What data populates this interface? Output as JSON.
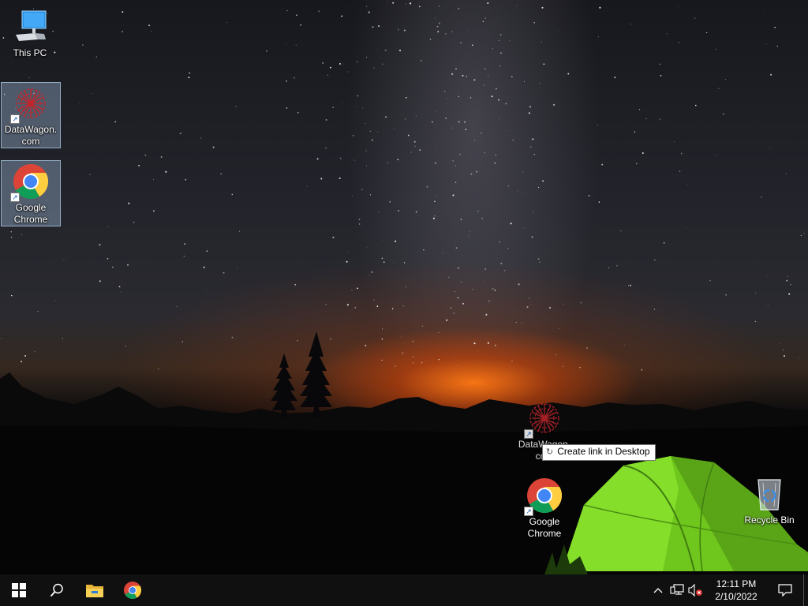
{
  "desktop": {
    "icons": {
      "this_pc": "This PC",
      "datawagon_left": "DataWagon.com",
      "chrome_left": "Google Chrome",
      "datawagon_drag": "DataWagon.com",
      "chrome_right": "Google Chrome",
      "recycle_bin": "Recycle Bin"
    },
    "tooltip": "Create link in Desktop"
  },
  "taskbar": {
    "start_icon": "windows-logo-icon",
    "search_icon": "search-icon",
    "pinned": [
      "file-explorer-icon",
      "chrome-icon"
    ],
    "tray": {
      "chevron": "^",
      "time": "12:11 PM",
      "date": "2/10/2022",
      "volume_state": "muted"
    }
  },
  "colors": {
    "taskbar": "#101010",
    "tent_green": "#7bd321",
    "selection": "#a0bedc",
    "glow": "#ff7814"
  }
}
